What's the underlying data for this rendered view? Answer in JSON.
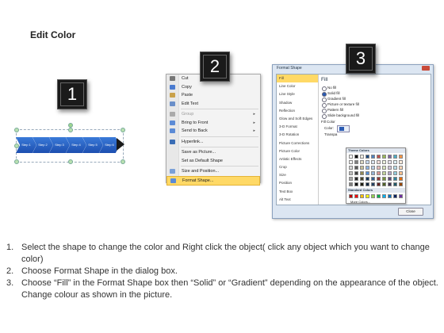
{
  "heading": "Edit Color",
  "badges": [
    "1",
    "2",
    "3"
  ],
  "step1": {
    "chevrons": [
      "Step 1",
      "Step 2",
      "Step 3",
      "Step 4",
      "Step 5",
      "Step 6"
    ]
  },
  "context_menu": {
    "items": [
      {
        "label": "Cut",
        "icon": "cut-icon",
        "submenu": false,
        "disabled": false,
        "color": "#777777"
      },
      {
        "label": "Copy",
        "icon": "copy-icon",
        "submenu": false,
        "disabled": false,
        "color": "#4a7bd0"
      },
      {
        "label": "Paste",
        "icon": "paste-icon",
        "submenu": false,
        "disabled": false,
        "color": "#c9a14a"
      },
      {
        "label": "Edit Text",
        "icon": "edit-text-icon",
        "submenu": false,
        "disabled": false,
        "color": "#6a8fc9"
      },
      {
        "label": "Group",
        "icon": "group-icon",
        "submenu": true,
        "disabled": true,
        "color": "#aaaaaa"
      },
      {
        "label": "Bring to Front",
        "icon": "bring-front-icon",
        "submenu": true,
        "disabled": false,
        "color": "#5c8bd6"
      },
      {
        "label": "Send to Back",
        "icon": "send-back-icon",
        "submenu": true,
        "disabled": false,
        "color": "#5c8bd6"
      },
      {
        "label": "Hyperlink...",
        "icon": "hyperlink-icon",
        "submenu": false,
        "disabled": false,
        "color": "#3a6db5"
      },
      {
        "label": "Save as Picture...",
        "icon": "",
        "submenu": false,
        "disabled": false,
        "color": ""
      },
      {
        "label": "Set as Default Shape",
        "icon": "",
        "submenu": false,
        "disabled": false,
        "color": ""
      },
      {
        "label": "Size and Position...",
        "icon": "size-icon",
        "submenu": false,
        "disabled": false,
        "color": "#7aa0d8"
      },
      {
        "label": "Format Shape...",
        "icon": "format-shape-icon",
        "submenu": false,
        "disabled": false,
        "color": "#5c8bd6",
        "highlighted": true
      }
    ]
  },
  "format_dialog": {
    "title": "Format Shape",
    "nav": [
      "Fill",
      "Line Color",
      "Line Style",
      "Shadow",
      "Reflection",
      "Glow and Soft Edges",
      "3-D Format",
      "3-D Rotation",
      "Picture Corrections",
      "Picture Color",
      "Artistic Effects",
      "Crop",
      "Size",
      "Position",
      "Text Box",
      "Alt Text"
    ],
    "active_nav": "Fill",
    "fill_heading": "Fill",
    "fill_options": [
      "No fill",
      "Solid fill",
      "Gradient fill",
      "Picture or texture fill",
      "Pattern fill",
      "Slide background fill"
    ],
    "selected_option": "Solid fill",
    "fill_color_label": "Fill Color",
    "color_label": "Color:",
    "transparency_label": "Transpa",
    "palette": {
      "theme_label": "Theme Colors",
      "standard_label": "Standard Colors",
      "more_label": "More Colors...",
      "theme_colors": [
        "#ffffff",
        "#000000",
        "#eeece1",
        "#1f497d",
        "#4f81bd",
        "#c0504d",
        "#9bbb59",
        "#8064a2",
        "#4bacc6",
        "#f79646",
        "#f2f2f2",
        "#7f7f7f",
        "#ddd9c3",
        "#c6d9f0",
        "#dbe5f1",
        "#f2dcdb",
        "#ebf1dd",
        "#e5e0ec",
        "#dbeef3",
        "#fdeada",
        "#d8d8d8",
        "#595959",
        "#c4bd97",
        "#8db3e2",
        "#b8cce4",
        "#e5b9b7",
        "#d7e3bc",
        "#ccc1d9",
        "#b7dde8",
        "#fbd5b5",
        "#bfbfbf",
        "#3f3f3f",
        "#938953",
        "#548dd4",
        "#95b3d7",
        "#d99694",
        "#c3d69b",
        "#b2a2c7",
        "#92cddc",
        "#fac08f",
        "#a5a5a5",
        "#262626",
        "#494429",
        "#17365d",
        "#366092",
        "#953734",
        "#76923c",
        "#5f497a",
        "#31859b",
        "#e36c09",
        "#7f7f7f",
        "#0c0c0c",
        "#1d1b10",
        "#0f243e",
        "#244061",
        "#632423",
        "#4f6128",
        "#3f3151",
        "#205867",
        "#974806"
      ],
      "standard_colors": [
        "#c00000",
        "#ff0000",
        "#ffc000",
        "#ffff00",
        "#92d050",
        "#00b050",
        "#00b0f0",
        "#0070c0",
        "#002060",
        "#7030a0"
      ]
    },
    "close_label": "Close"
  },
  "instructions": [
    {
      "num": "1.",
      "text": "Select the shape to change the color and Right click the object( click any object which you want to change color)"
    },
    {
      "num": "2.",
      "text": "Choose Format Shape in the dialog box."
    },
    {
      "num": "3.",
      "text": "Choose “Fill” in the Format Shape box then “Solid” or “Gradient” depending on the appearance of the object. Change colour as shown in the picture."
    }
  ]
}
